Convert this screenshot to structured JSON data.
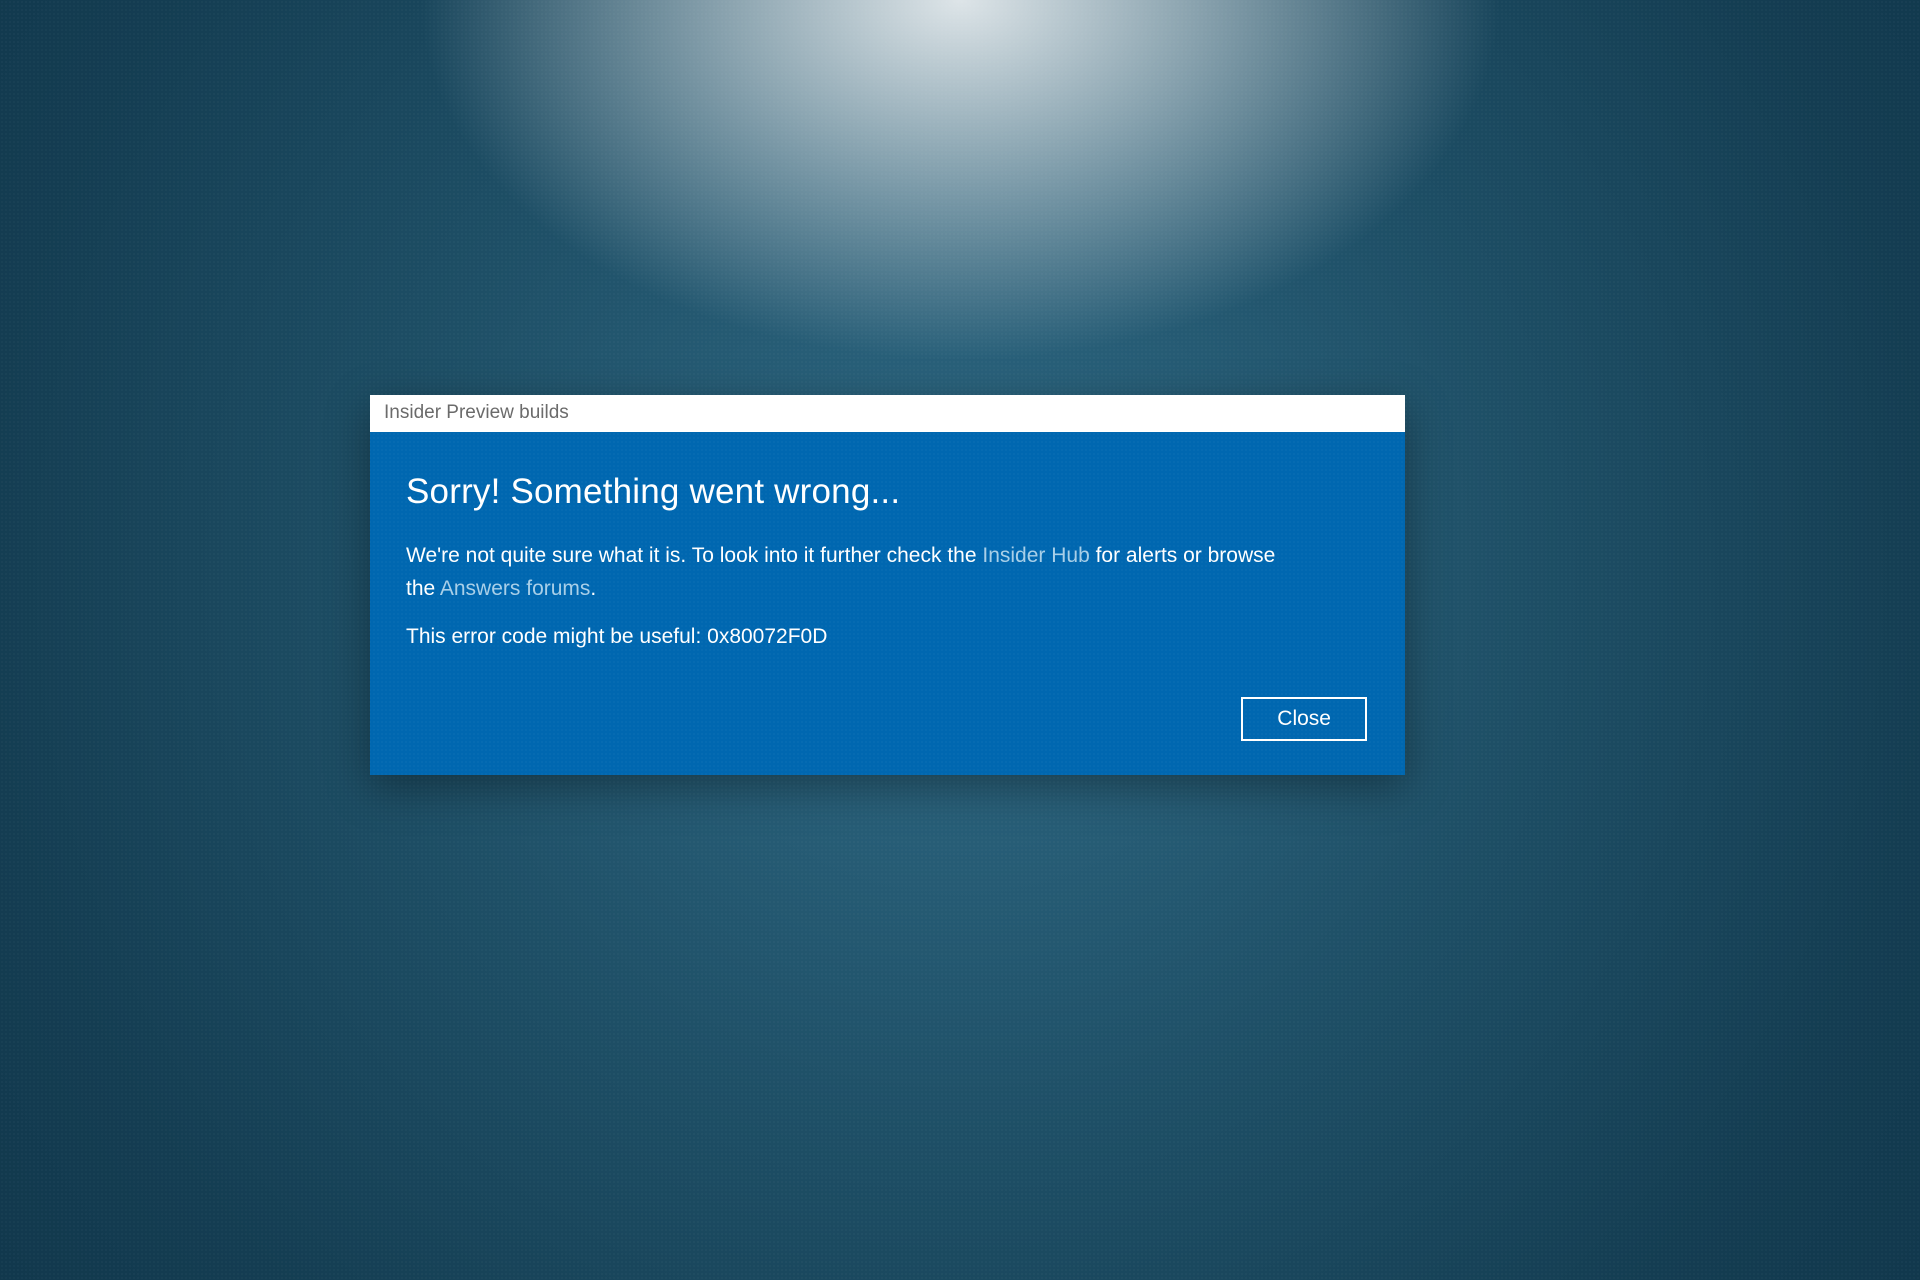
{
  "dialog": {
    "title": "Insider Preview builds",
    "heading": "Sorry! Something went wrong...",
    "message_pre": "We're not quite sure what it is. To look into it further check the ",
    "link1": "Insider Hub",
    "message_mid": " for alerts or browse the ",
    "link2": "Answers forums",
    "message_post": ".",
    "error_prefix": "This error code might be useful: ",
    "error_code": "0x80072F0D",
    "close_label": "Close"
  }
}
